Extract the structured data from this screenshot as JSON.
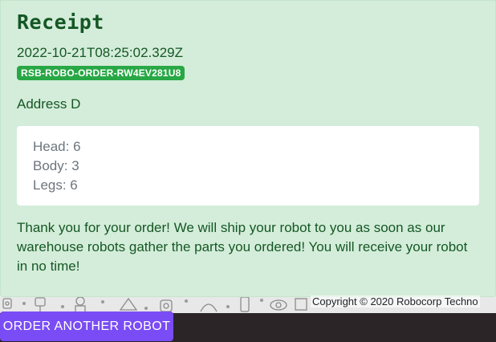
{
  "receipt": {
    "title": "Receipt",
    "timestamp": "2022-10-21T08:25:02.329Z",
    "order_id": "RSB-ROBO-ORDER-RW4EV281U8",
    "address": "Address D",
    "parts": [
      {
        "label": "Head: 6"
      },
      {
        "label": "Body: 3"
      },
      {
        "label": "Legs: 6"
      }
    ],
    "thank_you": "Thank you for your order! We will ship your robot to you as soon as our warehouse robots gather the parts you ordered! You will receive your robot in no time!"
  },
  "footer": {
    "copyright": "Copyright © 2020 Robocorp Techno",
    "order_another_label": "ORDER ANOTHER ROBOT"
  },
  "colors": {
    "receipt_bg": "#d4edda",
    "receipt_text": "#155724",
    "badge_bg": "#28a745",
    "button_bg": "#7a4cf5",
    "footer_bg": "#2b2528"
  }
}
